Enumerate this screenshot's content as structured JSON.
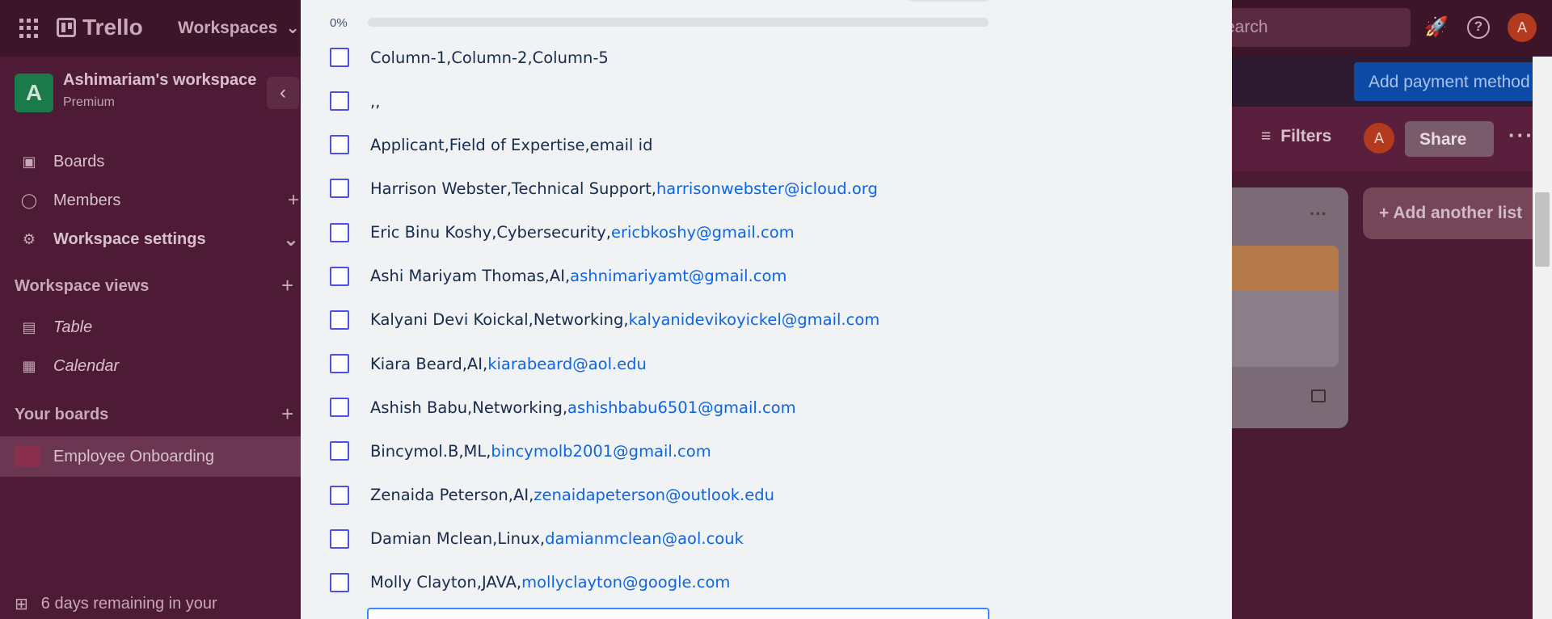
{
  "topnav": {
    "brand": "Trello",
    "workspaces_label": "Workspaces",
    "search_placeholder": "Search",
    "user_initial": "A"
  },
  "sidebar": {
    "workspace_initial": "A",
    "workspace_name": "Ashimariam's workspace",
    "workspace_plan": "Premium",
    "items": [
      {
        "label": "Boards",
        "icon": "board-icon"
      },
      {
        "label": "Members",
        "icon": "person-icon"
      },
      {
        "label": "Workspace settings",
        "icon": "gear-icon"
      }
    ],
    "views_title": "Workspace views",
    "views": [
      {
        "label": "Table",
        "icon": "table-icon"
      },
      {
        "label": "Calendar",
        "icon": "calendar-icon"
      }
    ],
    "boards_title": "Your boards",
    "boards": [
      {
        "label": "Employee Onboarding"
      }
    ],
    "trial_note": "6 days remaining in your"
  },
  "board": {
    "payment_button": "Add payment method",
    "filters_label": "Filters",
    "member_initial": "A",
    "share_label": "Share",
    "add_list_label": "Add another list"
  },
  "checklist": {
    "progress_label": "0%",
    "progress_percent": 0,
    "items": [
      {
        "text": "Column-1,Column-2,Column-5",
        "email": ""
      },
      {
        "text": ",,",
        "email": ""
      },
      {
        "text": "Applicant,Field of Expertise,email id",
        "email": ""
      },
      {
        "text": "Harrison Webster,Technical Support,",
        "email": "harrisonwebster@icloud.org"
      },
      {
        "text": "Eric Binu Koshy,Cybersecurity,",
        "email": "ericbkoshy@gmail.com"
      },
      {
        "text": "Ashi Mariyam Thomas,AI,",
        "email": "ashnimariyamt@gmail.com"
      },
      {
        "text": "Kalyani Devi Koickal,Networking,",
        "email": "kalyanidevikoyickel@gmail.com"
      },
      {
        "text": "Kiara Beard,AI,",
        "email": "kiarabeard@aol.edu"
      },
      {
        "text": "Ashish Babu,Networking,",
        "email": "ashishbabu6501@gmail.com"
      },
      {
        "text": "Bincymol.B,ML,",
        "email": "bincymolb2001@gmail.com"
      },
      {
        "text": "Zenaida Peterson,AI,",
        "email": "zenaidapeterson@outlook.edu"
      },
      {
        "text": "Damian Mclean,Linux,",
        "email": "damianmclean@aol.couk"
      },
      {
        "text": "Molly Clayton,JAVA,",
        "email": "mollyclayton@google.com"
      }
    ]
  }
}
